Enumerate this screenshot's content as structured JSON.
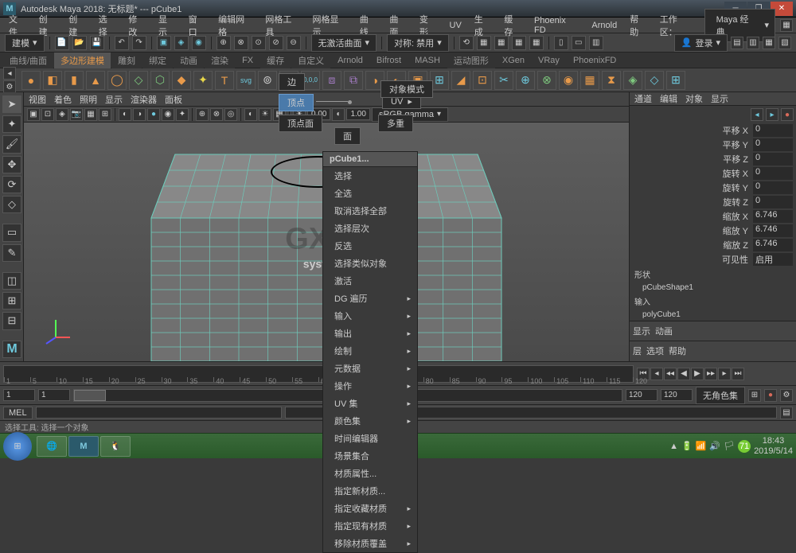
{
  "title": "Autodesk Maya 2018: 无标题*   ---   pCube1",
  "menu": [
    "文件",
    "创建",
    "创建",
    "选择",
    "修改",
    "显示",
    "窗口",
    "编辑网格",
    "网格工具",
    "网格显示",
    "曲线",
    "曲面",
    "变形",
    "UV",
    "生成",
    "缓存",
    "Phoenix FD",
    "Arnold",
    "帮助"
  ],
  "workspace_label": "工作区：",
  "workspace_value": "Maya 经典",
  "mode_dropdown": "建模",
  "viewport_mode": "无激活曲面",
  "sym_label": "对称: 禁用",
  "login": "登录",
  "shelf_tabs": [
    "曲线/曲面",
    "多边形建模",
    "雕刻",
    "绑定",
    "动画",
    "渲染",
    "FX",
    "缓存",
    "自定义",
    "Arnold",
    "Bifrost",
    "MASH",
    "运动图形",
    "XGen",
    "VRay",
    "PhoenixFD"
  ],
  "shelf_active": "多边形建模",
  "svg_label": "svg",
  "vp_menu": [
    "视图",
    "着色",
    "照明",
    "显示",
    "渲染器",
    "面板"
  ],
  "vp_num1": "0.00",
  "vp_num2": "1.00",
  "vp_gamma": "sRGB gamma",
  "marking": {
    "vertex": "顶点",
    "vertex_face": "顶点面",
    "edge": "边",
    "face": "面",
    "uv": "UV",
    "multi": "多重",
    "obj_mode": "对象模式"
  },
  "ctx": {
    "header": "pCube1...",
    "items": [
      "选择",
      "全选",
      "取消选择全部",
      "选择层次",
      "反选",
      "选择类似对象",
      "激活",
      [
        "DG 遍历",
        1
      ],
      [
        "输入",
        1
      ],
      [
        "输出",
        1
      ],
      [
        "绘制",
        1
      ],
      [
        "元数据",
        1
      ],
      [
        "操作",
        1
      ],
      [
        "UV 集",
        1
      ],
      [
        "颜色集",
        1
      ],
      "时间编辑器",
      "场景集合",
      "材质属性...",
      "指定新材质...",
      [
        "指定收藏材质",
        1
      ],
      [
        "指定现有材质",
        1
      ],
      [
        "移除材质覆盖",
        1
      ]
    ]
  },
  "cb": {
    "tabs": [
      "通道",
      "编辑",
      "对象",
      "显示"
    ],
    "attrs": [
      [
        "平移 X",
        "0"
      ],
      [
        "平移 Y",
        "0"
      ],
      [
        "平移 Z",
        "0"
      ],
      [
        "旋转 X",
        "0"
      ],
      [
        "旋转 Y",
        "0"
      ],
      [
        "旋转 Z",
        "0"
      ],
      [
        "缩放 X",
        "6.746"
      ],
      [
        "缩放 Y",
        "6.746"
      ],
      [
        "缩放 Z",
        "6.746"
      ],
      [
        "可见性",
        "启用"
      ]
    ],
    "shape_lbl": "形状",
    "shape": "pCubeShape1",
    "input_lbl": "输入",
    "input": "polyCube1",
    "bot_tabs": [
      "显示",
      "动画"
    ],
    "bot_row": [
      "层",
      "选项",
      "帮助"
    ]
  },
  "timeline_ticks": [
    1,
    5,
    10,
    15,
    20,
    25,
    30,
    35,
    40,
    45,
    50,
    55,
    60,
    65,
    70,
    75,
    80,
    85,
    90,
    95,
    100,
    105,
    110,
    115,
    120
  ],
  "range": {
    "start": "1",
    "end": "120",
    "start2": "1",
    "end2": "120"
  },
  "nocharset": "无角色集",
  "mel": "MEL",
  "help_text": "选择工具: 选择一个对象",
  "taskbar": {
    "time": "18:43",
    "date": "2019/5/14"
  }
}
